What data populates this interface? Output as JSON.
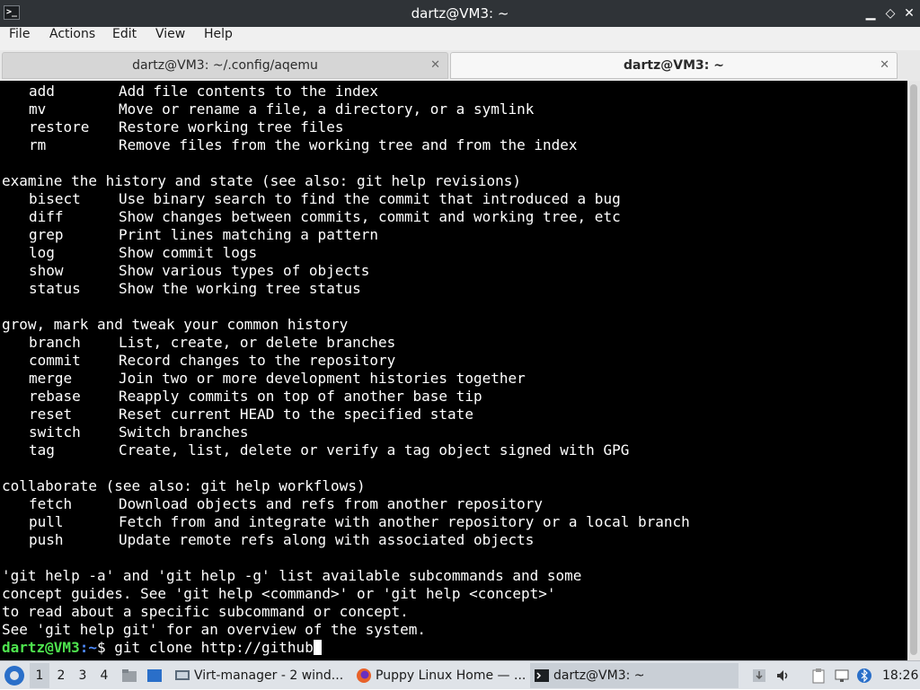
{
  "window": {
    "title": "dartz@VM3: ~",
    "app_icon": ">_",
    "minimize": "▁",
    "maximize": "◇",
    "close": "✕"
  },
  "menu": [
    "File",
    "Actions",
    "Edit",
    "View",
    "Help"
  ],
  "tabs": [
    {
      "label": "dartz@VM3: ~/.config/aqemu",
      "close": "✕",
      "active": false
    },
    {
      "label": "dartz@VM3: ~",
      "close": "✕",
      "active": true
    }
  ],
  "terminal": {
    "sections": [
      {
        "cmds": [
          [
            "add",
            "Add file contents to the index"
          ],
          [
            "mv",
            "Move or rename a file, a directory, or a symlink"
          ],
          [
            "restore",
            "Restore working tree files"
          ],
          [
            "rm",
            "Remove files from the working tree and from the index"
          ]
        ]
      },
      {
        "heading": "examine the history and state (see also: git help revisions)",
        "cmds": [
          [
            "bisect",
            "Use binary search to find the commit that introduced a bug"
          ],
          [
            "diff",
            "Show changes between commits, commit and working tree, etc"
          ],
          [
            "grep",
            "Print lines matching a pattern"
          ],
          [
            "log",
            "Show commit logs"
          ],
          [
            "show",
            "Show various types of objects"
          ],
          [
            "status",
            "Show the working tree status"
          ]
        ]
      },
      {
        "heading": "grow, mark and tweak your common history",
        "cmds": [
          [
            "branch",
            "List, create, or delete branches"
          ],
          [
            "commit",
            "Record changes to the repository"
          ],
          [
            "merge",
            "Join two or more development histories together"
          ],
          [
            "rebase",
            "Reapply commits on top of another base tip"
          ],
          [
            "reset",
            "Reset current HEAD to the specified state"
          ],
          [
            "switch",
            "Switch branches"
          ],
          [
            "tag",
            "Create, list, delete or verify a tag object signed with GPG"
          ]
        ]
      },
      {
        "heading": "collaborate (see also: git help workflows)",
        "cmds": [
          [
            "fetch",
            "Download objects and refs from another repository"
          ],
          [
            "pull",
            "Fetch from and integrate with another repository or a local branch"
          ],
          [
            "push",
            "Update remote refs along with associated objects"
          ]
        ]
      }
    ],
    "footer": [
      "'git help -a' and 'git help -g' list available subcommands and some",
      "concept guides. See 'git help <command>' or 'git help <concept>'",
      "to read about a specific subcommand or concept.",
      "See 'git help git' for an overview of the system."
    ],
    "prompt": {
      "user": "dartz@VM3",
      "sep": ":",
      "path": "~",
      "symbol": "$",
      "input": "git clone http://github"
    }
  },
  "taskbar": {
    "workspaces": [
      "1",
      "2",
      "3",
      "4"
    ],
    "current_workspace": "1",
    "tasks": [
      {
        "label": "Virt-manager - 2 wind...",
        "icon": "virt-manager-icon"
      },
      {
        "label": "Puppy Linux Home — ...",
        "icon": "firefox-icon"
      },
      {
        "label": "dartz@VM3: ~",
        "icon": "terminal-icon",
        "active": true
      }
    ],
    "clock": "18:26"
  },
  "colors": {
    "titlebar": "#2f3337",
    "terminal_bg": "#000000",
    "prompt_user": "#4ee44e",
    "prompt_path": "#4f8cff"
  }
}
